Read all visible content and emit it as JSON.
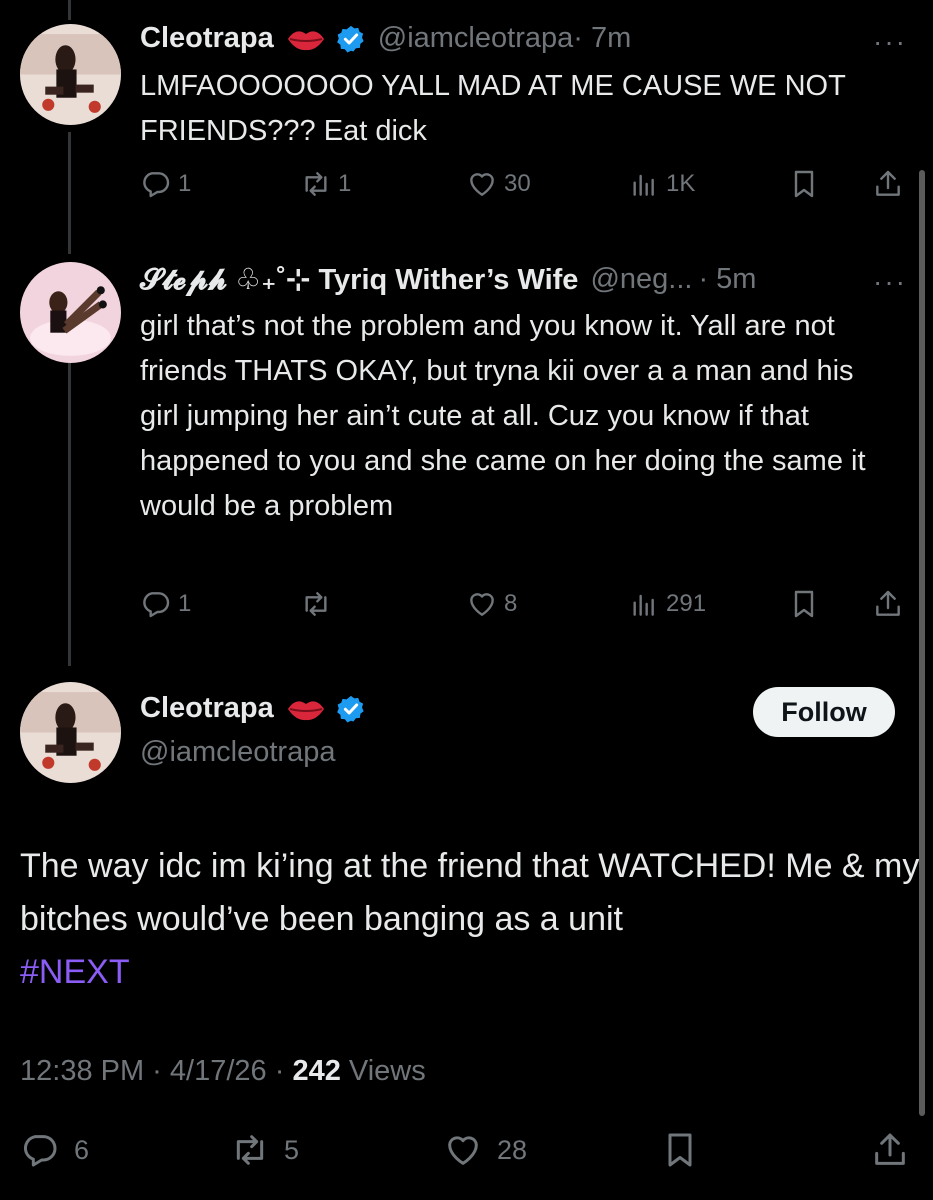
{
  "tweet1": {
    "name": "Cleotrapa",
    "handle": "@iamcleotrapa",
    "time": "· 7m",
    "more": "···",
    "text": "LMFAOOOOOOO YALL MAD AT ME CAUSE WE NOT FRIENDS??? Eat dick",
    "replies": "1",
    "reposts": "1",
    "likes": "30",
    "views": "1K"
  },
  "tweet2": {
    "name": "𝓢𝓽𝓮𝓹𝓱 ♧₊˚⊹ Tyriq Wither’s Wife",
    "handle": "@neg...",
    "time": "· 5m",
    "more": "···",
    "text": "girl that’s not the problem and you know it. Yall are not friends THATS OKAY, but tryna kii over a a man and his girl jumping her ain’t cute at all. Cuz you know if that happened to you and she came on her doing the same it would be a problem",
    "replies": "1",
    "reposts": "",
    "likes": "8",
    "views": "291"
  },
  "main": {
    "name": "Cleotrapa",
    "handle": "@iamcleotrapa",
    "follow_label": "Follow",
    "text": "The way idc im ki’ing at the friend that WATCHED! Me & my bitches would’ve been banging as a unit",
    "hashtag": "#NEXT",
    "time": "12:38 PM · 4/17/26 · ",
    "views_count": "242",
    "views_label": " Views",
    "replies": "6",
    "reposts": "5",
    "likes": "28"
  },
  "colors": {
    "background": "#000000",
    "text": "#e7e9ea",
    "muted": "#71767b",
    "verified": "#1d9bf0",
    "hashtag": "#8b5cf6",
    "follow_bg": "#eff3f4"
  },
  "icons": [
    "lips-icon",
    "verified-badge-icon",
    "reply-icon",
    "repost-icon",
    "like-icon",
    "views-icon",
    "bookmark-icon",
    "share-icon",
    "more-icon"
  ]
}
